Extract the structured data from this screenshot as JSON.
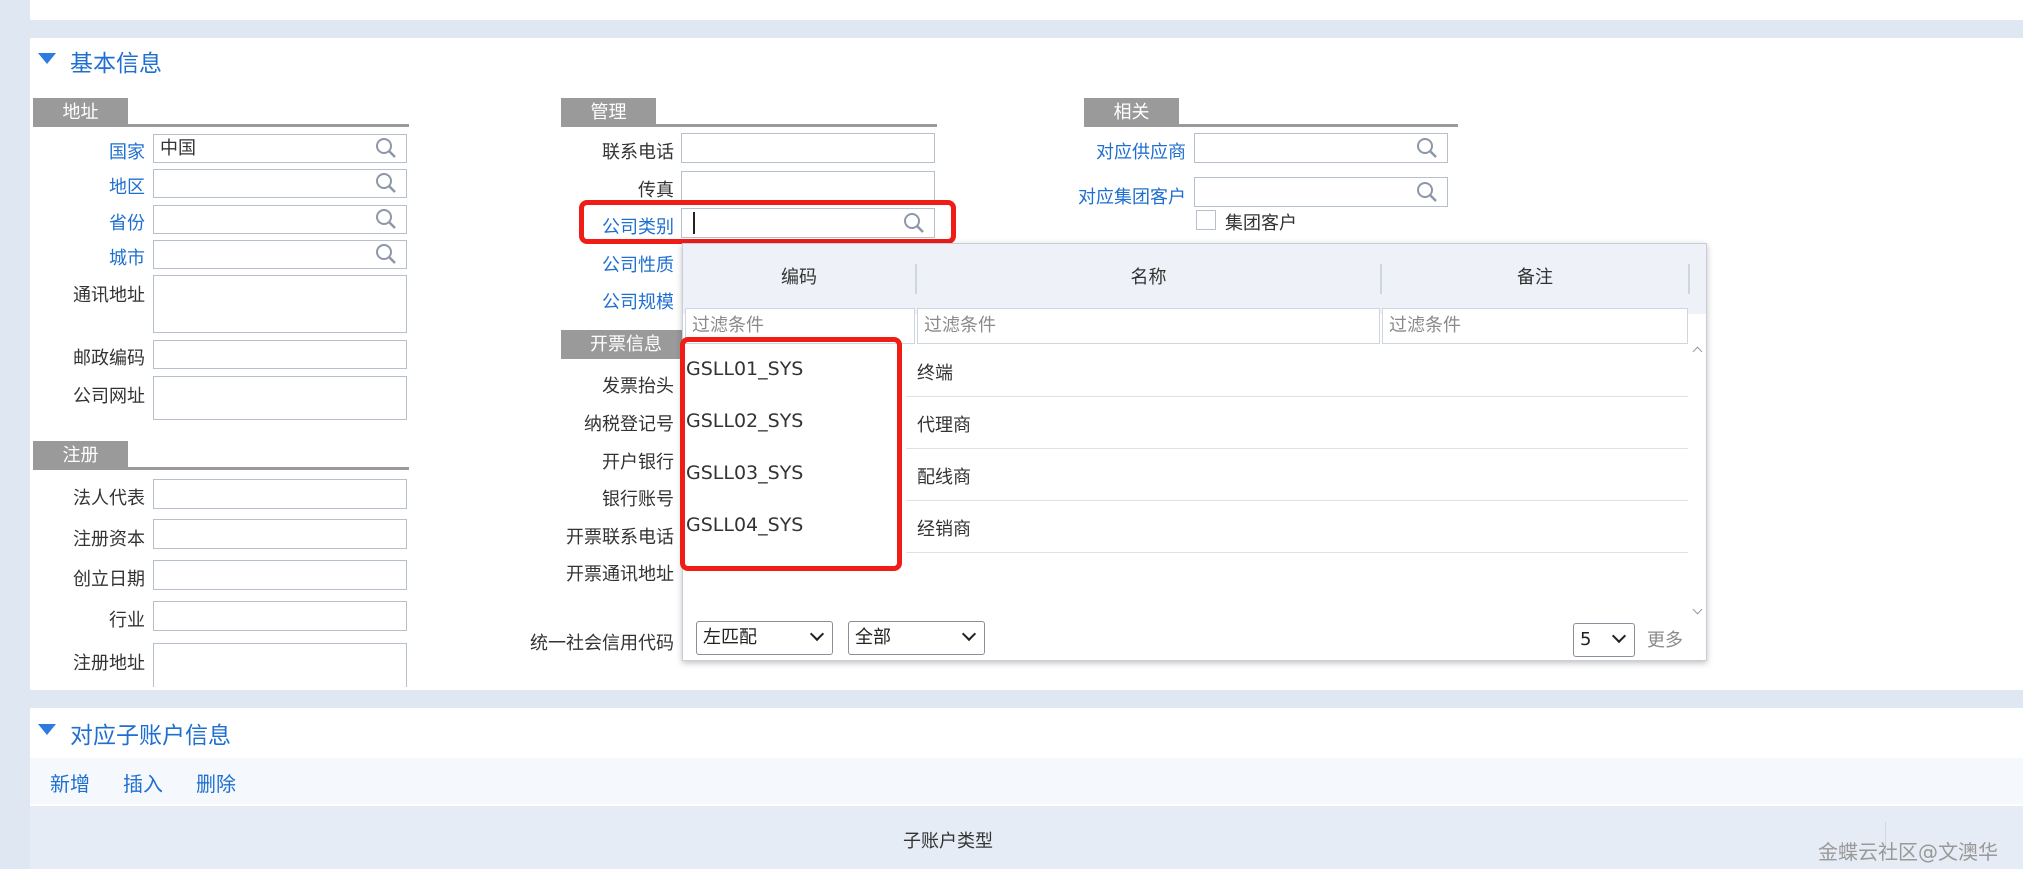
{
  "basic_info": {
    "title": "基本信息"
  },
  "address_group": {
    "title": "地址",
    "country_label": "国家",
    "country_value": "中国",
    "region_label": "地区",
    "province_label": "省份",
    "city_label": "城市",
    "mail_address_label": "通讯地址",
    "postal_code_label": "邮政编码",
    "website_label": "公司网址"
  },
  "registration_group": {
    "title": "注册",
    "legal_rep_label": "法人代表",
    "reg_capital_label": "注册资本",
    "founded_label": "创立日期",
    "industry_label": "行业",
    "reg_address_label": "注册地址"
  },
  "management_group": {
    "title": "管理",
    "phone_label": "联系电话",
    "fax_label": "传真",
    "company_type_label": "公司类别",
    "company_nature_label": "公司性质",
    "company_scale_label": "公司规模"
  },
  "invoice_group": {
    "title": "开票信息",
    "invoice_title_label": "发票抬头",
    "tax_no_label": "纳税登记号",
    "bank_label": "开户银行",
    "account_label": "银行账号",
    "invoice_phone_label": "开票联系电话",
    "invoice_address_label": "开票通讯地址",
    "credit_code_label": "统一社会信用代码"
  },
  "related_group": {
    "title": "相关",
    "supplier_label": "对应供应商",
    "group_customer_label": "对应集团客户",
    "group_customer_checkbox_label": "集团客户"
  },
  "lookup": {
    "columns": [
      "编码",
      "名称",
      "备注"
    ],
    "filter_placeholder": "过滤条件",
    "rows": [
      {
        "code": "GSLL01_SYS",
        "name": "终端"
      },
      {
        "code": "GSLL02_SYS",
        "name": "代理商"
      },
      {
        "code": "GSLL03_SYS",
        "name": "配线商"
      },
      {
        "code": "GSLL04_SYS",
        "name": "经销商"
      }
    ],
    "match_mode": "左匹配",
    "scope": "全部",
    "page_size": "5",
    "more_label": "更多"
  },
  "sub_account": {
    "title": "对应子账户信息",
    "add_label": "新增",
    "insert_label": "插入",
    "delete_label": "删除",
    "column_header": "子账户类型"
  },
  "watermark": "金蝶云社区@文澳华",
  "colors": {
    "accent": "#1f6fd1",
    "highlight": "#f01c16",
    "group_tab": "#9a9a9a",
    "page_bg": "#dfe7f3"
  }
}
